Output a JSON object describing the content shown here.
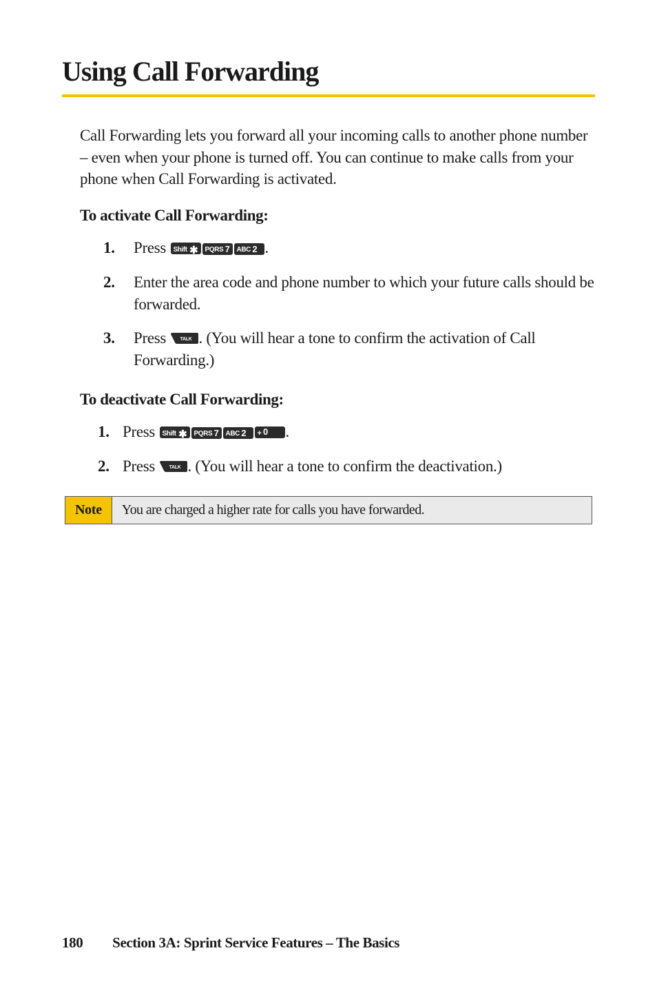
{
  "title": "Using Call Forwarding",
  "intro": "Call Forwarding lets you forward all your incoming calls to another phone number – even when your phone is turned off. You can continue to make calls from your phone when Call Forwarding is activated.",
  "activate": {
    "heading": "To activate Call Forwarding:",
    "steps": [
      {
        "num": "1.",
        "pre": "Press ",
        "keys": [
          "shift_star",
          "pqrs_7",
          "abc_2"
        ],
        "post": "."
      },
      {
        "num": "2.",
        "text": "Enter the area code and phone number to which your future calls should be forwarded."
      },
      {
        "num": "3.",
        "pre": "Press ",
        "keys": [
          "talk"
        ],
        "post": ". (You will hear a tone to confirm the activation of Call Forwarding.)"
      }
    ]
  },
  "deactivate": {
    "heading": "To deactivate Call Forwarding:",
    "steps": [
      {
        "num": "1.",
        "pre": "Press ",
        "keys": [
          "shift_star",
          "pqrs_7",
          "abc_2",
          "plus_0"
        ],
        "post": "."
      },
      {
        "num": "2.",
        "pre": "Press ",
        "keys": [
          "talk"
        ],
        "post": ". (You will hear a tone to confirm the deactivation.)"
      }
    ]
  },
  "note": {
    "label": "Note",
    "text": "You are charged a higher rate for calls you have forwarded."
  },
  "footer": {
    "page": "180",
    "section": "Section 3A: Sprint Service Features – The Basics"
  },
  "key_defs": {
    "shift_star": {
      "small": "Shift",
      "big": "✱",
      "big_class": "star"
    },
    "pqrs_7": {
      "small": "PQRS",
      "big": "7",
      "big_class": "big"
    },
    "abc_2": {
      "small": "ABC",
      "big": "2",
      "big_class": "big"
    },
    "plus_0": {
      "small": "+",
      "big": "0",
      "big_class": "zero",
      "small_style": "font-size:11px;"
    }
  }
}
